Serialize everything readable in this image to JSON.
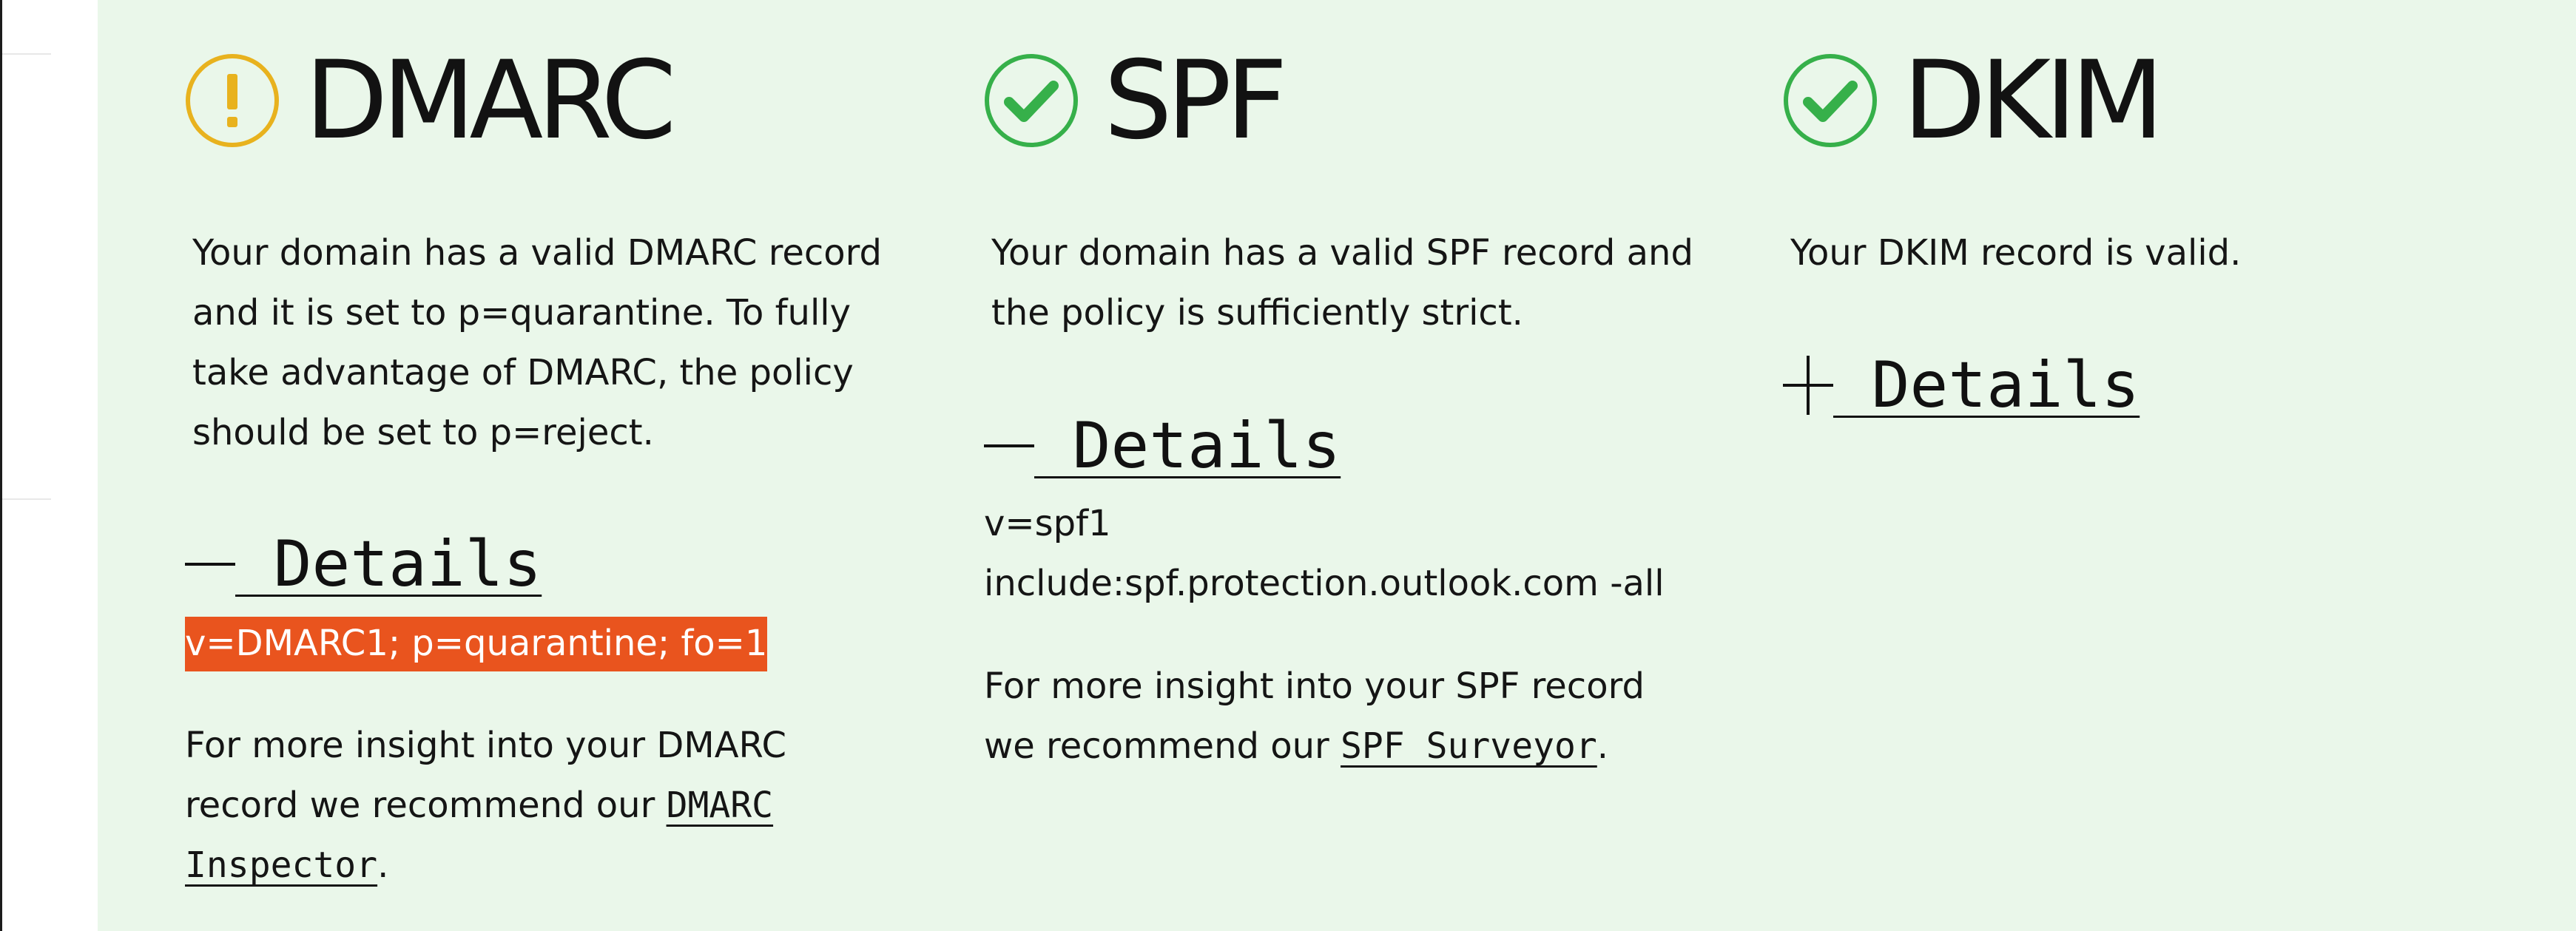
{
  "colors": {
    "panel_background": "#eaf7ea",
    "warning": "#e8b21e",
    "success": "#36b04a",
    "record_highlight": "#e9541e"
  },
  "dmarc": {
    "title": "DMARC",
    "status": "warning",
    "icon": "exclamation-circle-icon",
    "description": "Your domain has a valid DMARC record\nand it is set to p=quarantine. To fully\ntake advantage of DMARC, the policy\nshould be set to p=reject.",
    "details_toggle": "—",
    "details_label": " Details",
    "details_expanded": true,
    "record": "v=DMARC1; p=quarantine; fo=1",
    "insight_text": "For more insight into your DMARC record we recommend our ",
    "insight_link": "DMARC Inspector",
    "insight_suffix": "."
  },
  "spf": {
    "title": "SPF",
    "status": "valid",
    "icon": "check-circle-icon",
    "description": "Your domain has a valid SPF record and\nthe policy is sufficiently strict.",
    "details_toggle": "—",
    "details_label": " Details",
    "details_expanded": true,
    "record": "v=spf1\ninclude:spf.protection.outlook.com -all",
    "insight_text": "For more insight into your SPF record\nwe recommend our ",
    "insight_link": "SPF Surveyor",
    "insight_suffix": "."
  },
  "dkim": {
    "title": "DKIM",
    "status": "valid",
    "icon": "check-circle-icon",
    "description": "Your DKIM record is valid.",
    "details_toggle": "+",
    "details_label": " Details",
    "details_expanded": false
  }
}
